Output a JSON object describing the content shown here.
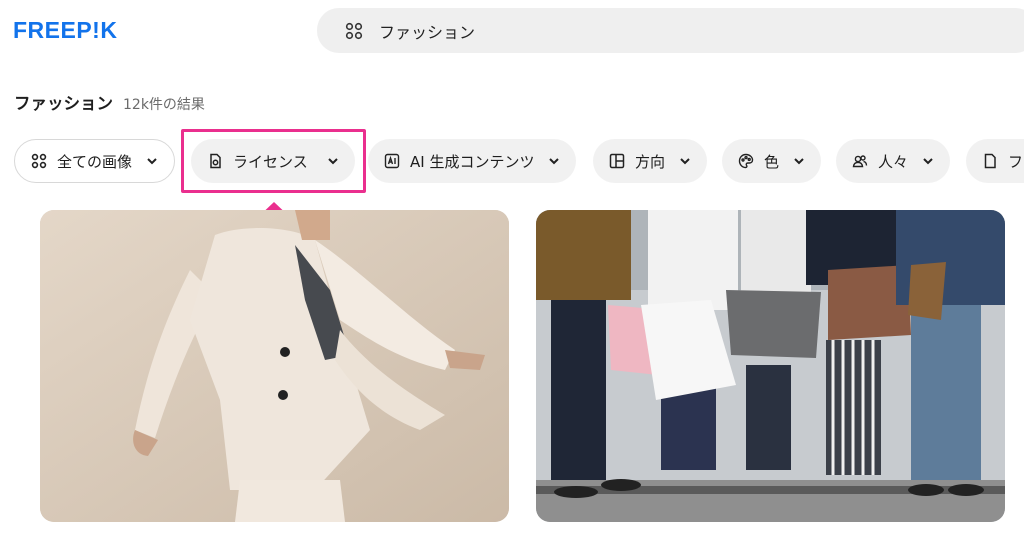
{
  "header": {
    "logo": "FREEP!K",
    "search_value": "ファッション"
  },
  "results": {
    "title": "ファッション",
    "count": "12k件の結果"
  },
  "filters": [
    {
      "label": "全ての画像",
      "icon": "grid-icon"
    },
    {
      "label": "ライセンス",
      "icon": "license-icon"
    },
    {
      "label": "AI 生成コンテンツ",
      "icon": "ai-icon"
    },
    {
      "label": "方向",
      "icon": "layout-icon"
    },
    {
      "label": "色",
      "icon": "palette-icon"
    },
    {
      "label": "人々",
      "icon": "people-icon"
    },
    {
      "label": "フ",
      "icon": "file-icon"
    }
  ],
  "annotation": {
    "highlight_color": "#ea2f8e",
    "highlighted_filter": "ライセンス"
  },
  "colors": {
    "brand": "#1273eb",
    "chip_bg": "#f1f1f1",
    "search_bg": "#efefef"
  },
  "images": [
    {
      "subject": "woman-in-beige-suit-photo"
    },
    {
      "subject": "shoppers-with-bags-photo"
    }
  ]
}
